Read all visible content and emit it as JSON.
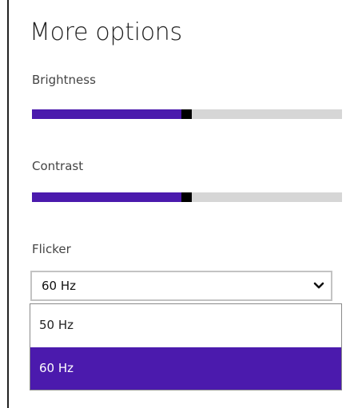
{
  "panel": {
    "title": "More options"
  },
  "brightness": {
    "label": "Brightness",
    "value_fraction": 0.5
  },
  "contrast": {
    "label": "Contrast",
    "value_fraction": 0.5
  },
  "flicker": {
    "label": "Flicker",
    "selected": "60 Hz",
    "options": [
      "50 Hz",
      "60 Hz"
    ],
    "highlighted_index": 1
  },
  "colors": {
    "accent": "#4b1aad",
    "track": "#d6d6d6",
    "thumb": "#000000"
  },
  "icons": {
    "dropdown": "chevron-down-icon"
  }
}
